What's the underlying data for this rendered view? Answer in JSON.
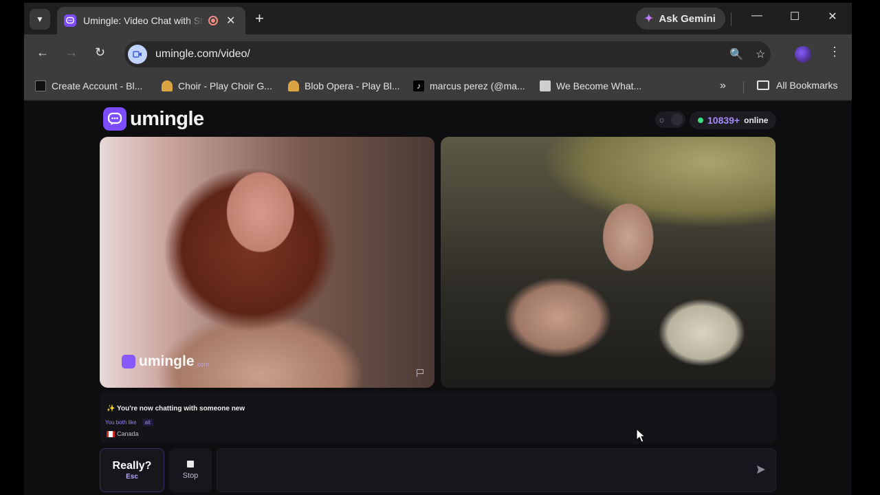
{
  "browser": {
    "tab_title": "Umingle: Video Chat with Strangers",
    "new_tab": "+",
    "gemini_label": "Ask Gemini",
    "url": "umingle.com/video/",
    "bookmarks": [
      {
        "label": "Create Account - Bl...",
        "icon_color": "#ffffff"
      },
      {
        "label": "Choir - Play Choir G...",
        "icon_color": "#d9a441"
      },
      {
        "label": "Blob Opera - Play Bl...",
        "icon_color": "#d9a441"
      },
      {
        "label": "marcus perez (@ma...",
        "icon_color": "#000000"
      },
      {
        "label": "We Become What...",
        "icon_color": "#cfcfcf"
      }
    ],
    "all_bookmarks": "All Bookmarks"
  },
  "site": {
    "logo_text": "umingle",
    "online_count": "10839+",
    "online_label": "online",
    "watermark_text": "umingle",
    "watermark_suffix": ".com",
    "accent": "#7c4dff"
  },
  "chat": {
    "status": "✨ You're now chatting with someone new",
    "both_like_label": "You both like",
    "both_like_tag": "alt",
    "country": "Canada"
  },
  "controls": {
    "next_label": "Really?",
    "next_key": "Esc",
    "stop_label": "Stop",
    "message_placeholder": ""
  }
}
